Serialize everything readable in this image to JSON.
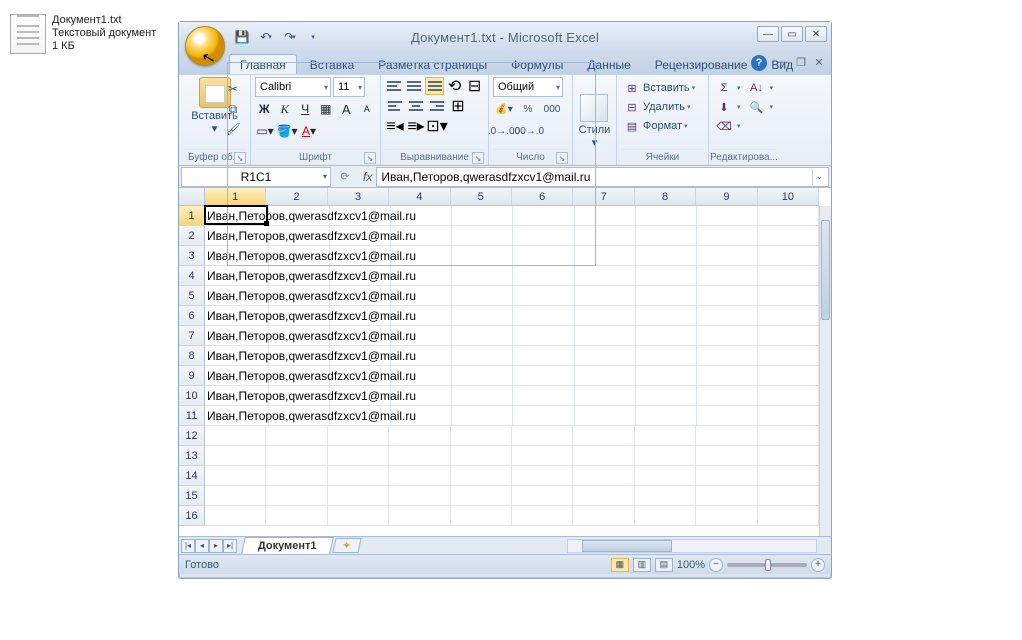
{
  "desktop": {
    "file_name": "Документ1.txt",
    "file_type": "Текстовый документ",
    "file_size": "1 КБ"
  },
  "titlebar": {
    "title": "Документ1.txt - Microsoft Excel"
  },
  "tabs": {
    "home": "Главная",
    "insert": "Вставка",
    "layout": "Разметка страницы",
    "formulas": "Формулы",
    "data": "Данные",
    "review": "Рецензирование",
    "view": "Вид"
  },
  "ribbon": {
    "clipboard": {
      "paste": "Вставить",
      "label": "Буфер об..."
    },
    "font": {
      "name": "Calibri",
      "size": "11",
      "bold": "Ж",
      "italic": "К",
      "underline": "Ч",
      "label": "Шрифт"
    },
    "align": {
      "label": "Выравнивание"
    },
    "number": {
      "format": "Общий",
      "percent": "%",
      "thousand": "000",
      "label": "Число"
    },
    "styles": {
      "btn": "Стили"
    },
    "cells": {
      "insert": "Вставить",
      "delete": "Удалить",
      "format": "Формат",
      "label": "Ячейки"
    },
    "editing": {
      "label": "Редактирова..."
    }
  },
  "namebox": "R1C1",
  "formula_bar": "Иван,Петоров,qwerasdfzxcv1@mail.ru",
  "columns": [
    "1",
    "2",
    "3",
    "4",
    "5",
    "6",
    "7",
    "8",
    "9",
    "10"
  ],
  "rows": [
    "1",
    "2",
    "3",
    "4",
    "5",
    "6",
    "7",
    "8",
    "9",
    "10",
    "11",
    "12",
    "13",
    "14",
    "15",
    "16"
  ],
  "cells": {
    "r1": "Иван,Петоров,qwerasdfzxcv1@mail.ru",
    "r2": "Иван,Петоров,qwerasdfzxcv1@mail.ru",
    "r3": "Иван,Петоров,qwerasdfzxcv1@mail.ru",
    "r4": "Иван,Петоров,qwerasdfzxcv1@mail.ru",
    "r5": "Иван,Петоров,qwerasdfzxcv1@mail.ru",
    "r6": "Иван,Петоров,qwerasdfzxcv1@mail.ru",
    "r7": "Иван,Петоров,qwerasdfzxcv1@mail.ru",
    "r8": "Иван,Петоров,qwerasdfzxcv1@mail.ru",
    "r9": "Иван,Петоров,qwerasdfzxcv1@mail.ru",
    "r10": "Иван,Петоров,qwerasdfzxcv1@mail.ru",
    "r11": "Иван,Петоров,qwerasdfzxcv1@mail.ru"
  },
  "sheet_tab": "Документ1",
  "status": {
    "ready": "Готово",
    "zoom": "100%"
  }
}
